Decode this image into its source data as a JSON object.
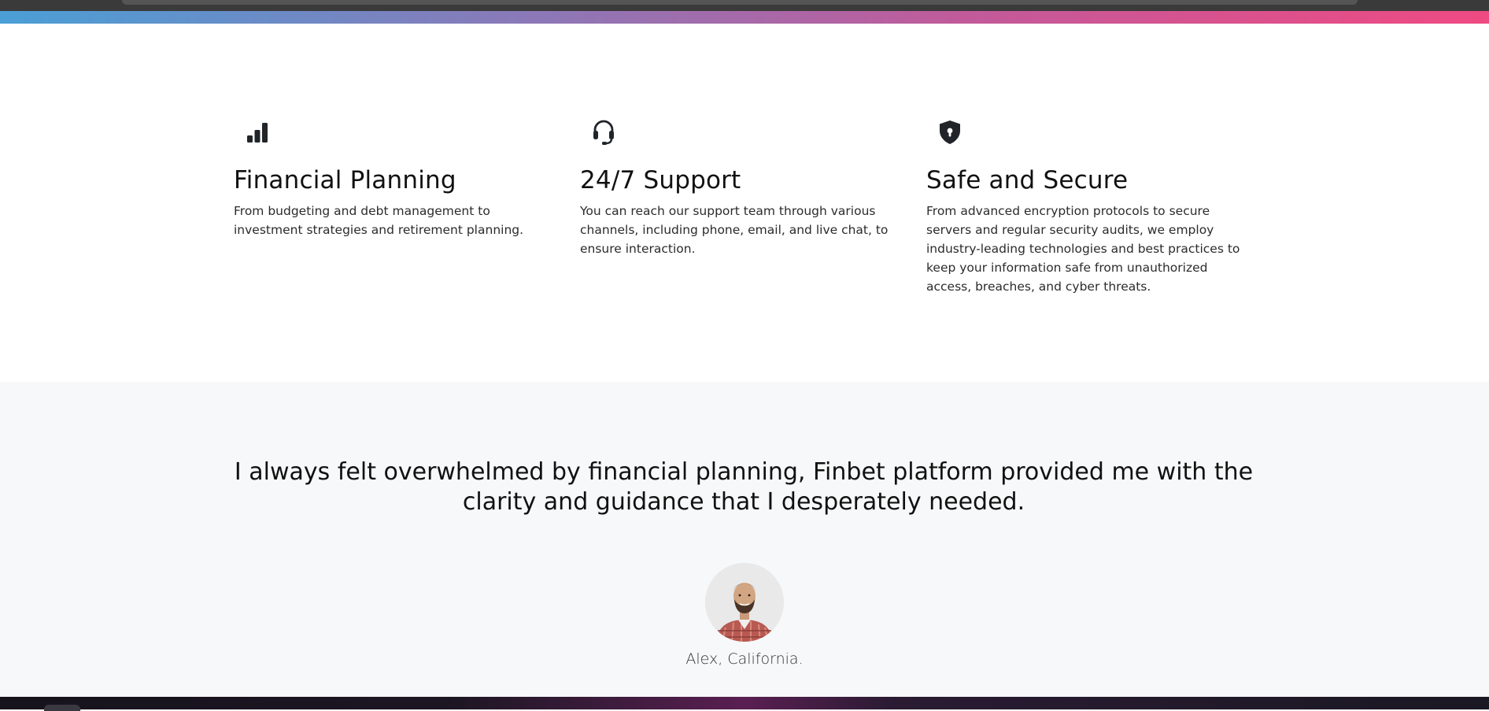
{
  "features": [
    {
      "icon": "bar-chart-icon",
      "title": "Financial Planning",
      "text": "From budgeting and debt management to investment strategies and retirement planning."
    },
    {
      "icon": "headset-icon",
      "title": "24/7 Support",
      "text": "You can reach our support team through various channels, including phone, email, and live chat, to ensure interaction."
    },
    {
      "icon": "shield-lock-icon",
      "title": "Safe and Secure",
      "text": "From advanced encryption protocols to secure servers and regular security audits, we employ industry-leading technologies and best practices to keep your information safe from unauthorized access, breaches, and cyber threats."
    }
  ],
  "testimonial": {
    "quote": "I always felt overwhelmed by financial planning, Finbet platform provided me with the clarity and guidance that I desperately needed.",
    "author": "Alex, California."
  },
  "colors": {
    "gradient_start": "#4a9fd6",
    "gradient_end": "#ef4a82",
    "section_bg": "#f7f8f9",
    "heading": "#111111"
  }
}
